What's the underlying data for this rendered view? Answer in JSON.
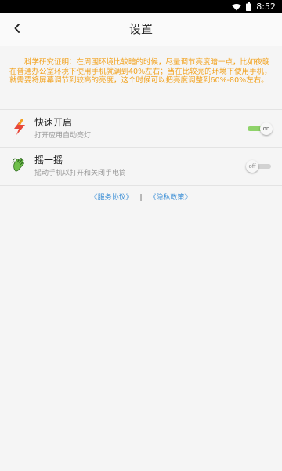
{
  "status_bar": {
    "time": "8:52",
    "icons": [
      "wifi-icon",
      "battery-icon"
    ]
  },
  "header": {
    "title": "设置",
    "back_icon": "chevron-left-icon"
  },
  "notice": {
    "text": "科学研究证明：在周围环境比较暗的时候，尽量调节亮度暗一点，比如夜晚在普通办公室环境下使用手机就调到40%左右；当在比较亮的环境下使用手机，就需要将屏幕调节到较高的亮度，这个时候可以把亮度调整到60%-80%左右。",
    "color": "#f2a21e"
  },
  "settings": [
    {
      "title": "快速开启",
      "desc": "打开应用自动亮灯",
      "icon": "lightning-icon",
      "toggle_label": "on",
      "enabled": true
    },
    {
      "title": "摇一摇",
      "desc": "摇动手机以打开和关闭手电筒",
      "icon": "shake-hand-icon",
      "toggle_label": "off",
      "enabled": false
    }
  ],
  "footer": {
    "service_agreement": "《服务协议》",
    "separator": "|",
    "privacy_policy": "《隐私政策》",
    "link_color": "#3c8fd6"
  },
  "colors": {
    "toggle_on": "#8fd36a",
    "toggle_off": "#d2d2d2",
    "background": "#f5f5f5"
  }
}
